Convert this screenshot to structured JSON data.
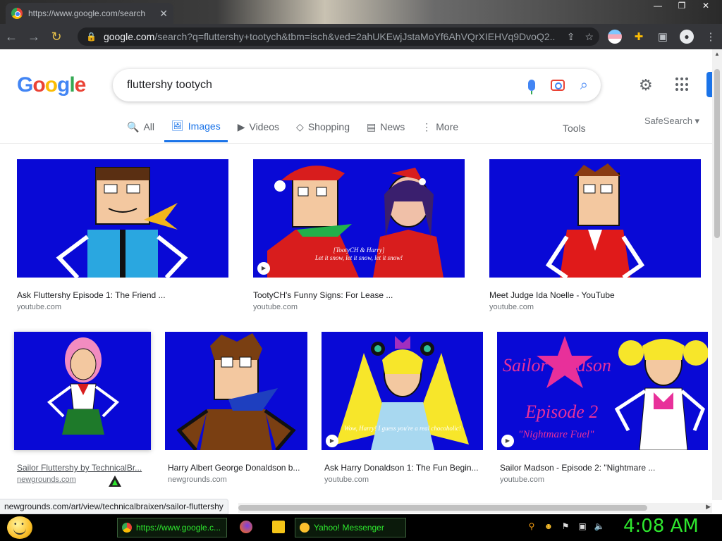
{
  "browser": {
    "tab_title": "https://www.google.com/search",
    "tab_close": "✕",
    "url_domain": "google.com",
    "url_path": "/search?q=fluttershy+tootych&tbm=isch&ved=2ahUKEwjJstaMoYf6AhVQrXIEHVq9DvoQ2..."
  },
  "search": {
    "logo": [
      "G",
      "o",
      "o",
      "g",
      "l",
      "e"
    ],
    "query": "fluttershy tootych"
  },
  "tabs": [
    {
      "label": "All",
      "icon": "search-icon",
      "glyph": "🔍"
    },
    {
      "label": "Images",
      "icon": "image-icon",
      "glyph": "🖼"
    },
    {
      "label": "Videos",
      "icon": "play-icon",
      "glyph": "▶"
    },
    {
      "label": "Shopping",
      "icon": "tag-icon",
      "glyph": "◇"
    },
    {
      "label": "News",
      "icon": "news-icon",
      "glyph": "▤"
    },
    {
      "label": "More",
      "icon": "more-vert-icon",
      "glyph": "⋮"
    }
  ],
  "tools_label": "Tools",
  "safesearch_label": "SafeSearch ▾",
  "results": [
    {
      "title": "Ask Fluttershy Episode 1: The Friend ...",
      "source": "youtube.com",
      "video": false
    },
    {
      "title": "TootyCH's Funny Signs: For Lease ...",
      "source": "youtube.com",
      "video": true,
      "caption": "[TootyCH & Harry] Let it snow, let it snow, let it snow!"
    },
    {
      "title": "Meet Judge Ida Noelle - YouTube",
      "source": "youtube.com",
      "video": false
    },
    {
      "title": "Sailor Fluttershy by TechnicalBr...",
      "source": "newgrounds.com",
      "video": false
    },
    {
      "title": "Harry Albert George Donaldson b...",
      "source": "newgrounds.com",
      "video": false
    },
    {
      "title": "Ask Harry Donaldson 1: The Fun Begin...",
      "source": "youtube.com",
      "video": true,
      "caption": "Wow, Harry! I guess you're a real chocoholic!"
    },
    {
      "title": "Sailor Madson - Episode 2: \"Nightmare ...",
      "source": "youtube.com",
      "video": true,
      "caption": "Sailor Madson Episode 2 \"Nightmare Fuel\""
    }
  ],
  "status_url": "newgrounds.com/art/view/technicalbraixen/sailor-fluttershy",
  "taskbar": {
    "chrome_task": "https://www.google.c...",
    "yahoo_task": "Yahoo! Messenger",
    "clock": "4:08 AM"
  }
}
